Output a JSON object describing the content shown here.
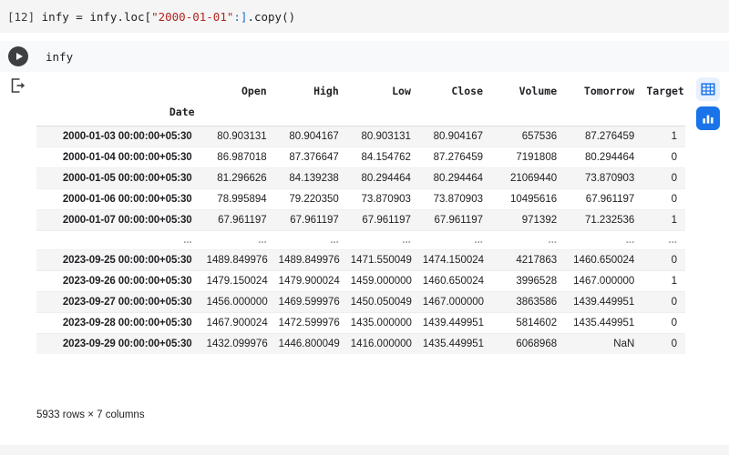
{
  "code_cell": {
    "prompt": "[12]",
    "segments": [
      {
        "text": "infy = infy.loc[",
        "type": "plain"
      },
      {
        "text": "\"2000-01-01\"",
        "type": "str"
      },
      {
        "text": ":]",
        "type": "punct"
      },
      {
        "text": ".copy()",
        "type": "plain"
      }
    ],
    "full_text": "[12] infy = infy.loc[\"2000-01-01\":].copy()"
  },
  "run_cell": {
    "play_icon": "play-icon",
    "code": "infy"
  },
  "output": {
    "gutter_icon": "output-export-icon",
    "actions": [
      {
        "name": "view-as-table",
        "icon": "table-icon",
        "color": "#1a73e8",
        "bg": "#e8f0fe"
      },
      {
        "name": "view-as-chart",
        "icon": "bar-chart-icon",
        "color": "#ffffff",
        "bg": "#1a73e8"
      }
    ]
  },
  "dataframe": {
    "index_name": "Date",
    "columns": [
      "Open",
      "High",
      "Low",
      "Close",
      "Volume",
      "Tomorrow",
      "Target"
    ],
    "ellipsis": "...",
    "rows": [
      {
        "index": "2000-01-03 00:00:00+05:30",
        "values": [
          "80.903131",
          "80.904167",
          "80.903131",
          "80.904167",
          "657536",
          "87.276459",
          "1"
        ]
      },
      {
        "index": "2000-01-04 00:00:00+05:30",
        "values": [
          "86.987018",
          "87.376647",
          "84.154762",
          "87.276459",
          "7191808",
          "80.294464",
          "0"
        ]
      },
      {
        "index": "2000-01-05 00:00:00+05:30",
        "values": [
          "81.296626",
          "84.139238",
          "80.294464",
          "80.294464",
          "21069440",
          "73.870903",
          "0"
        ]
      },
      {
        "index": "2000-01-06 00:00:00+05:30",
        "values": [
          "78.995894",
          "79.220350",
          "73.870903",
          "73.870903",
          "10495616",
          "67.961197",
          "0"
        ]
      },
      {
        "index": "2000-01-07 00:00:00+05:30",
        "values": [
          "67.961197",
          "67.961197",
          "67.961197",
          "67.961197",
          "971392",
          "71.232536",
          "1"
        ]
      },
      {
        "index": "2023-09-25 00:00:00+05:30",
        "values": [
          "1489.849976",
          "1489.849976",
          "1471.550049",
          "1474.150024",
          "4217863",
          "1460.650024",
          "0"
        ]
      },
      {
        "index": "2023-09-26 00:00:00+05:30",
        "values": [
          "1479.150024",
          "1479.900024",
          "1459.000000",
          "1460.650024",
          "3996528",
          "1467.000000",
          "1"
        ]
      },
      {
        "index": "2023-09-27 00:00:00+05:30",
        "values": [
          "1456.000000",
          "1469.599976",
          "1450.050049",
          "1467.000000",
          "3863586",
          "1439.449951",
          "0"
        ]
      },
      {
        "index": "2023-09-28 00:00:00+05:30",
        "values": [
          "1467.900024",
          "1472.599976",
          "1435.000000",
          "1439.449951",
          "5814602",
          "1435.449951",
          "0"
        ]
      },
      {
        "index": "2023-09-29 00:00:00+05:30",
        "values": [
          "1432.099976",
          "1446.800049",
          "1416.000000",
          "1435.449951",
          "6068968",
          "NaN",
          "0"
        ]
      }
    ],
    "shape_text": "5933 rows × 7 columns"
  }
}
